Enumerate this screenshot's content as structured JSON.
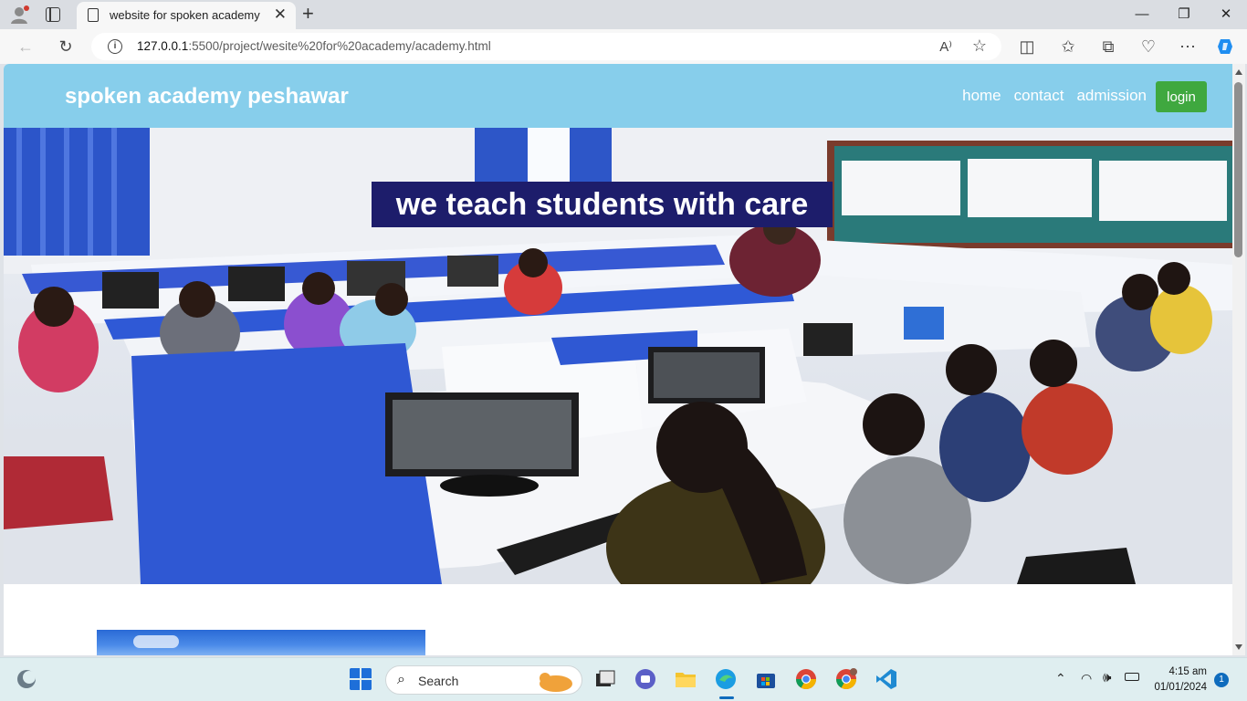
{
  "browser": {
    "tab_title": "website for spoken academy",
    "url_host": "127.0.0.1",
    "url_path": ":5500/project/wesite%20for%20academy/academy.html"
  },
  "site": {
    "brand": "spoken academy peshawar",
    "nav": [
      "home",
      "contact",
      "admission"
    ],
    "login_label": "login",
    "hero_caption": "we teach students with care"
  },
  "taskbar": {
    "search_label": "Search",
    "time": "4:15 am",
    "date": "01/01/2024",
    "notifications": "1"
  },
  "colors": {
    "header_bg": "#87ceeb",
    "login_bg": "#3fa83f",
    "caption_bg": "#1d1d6b"
  }
}
